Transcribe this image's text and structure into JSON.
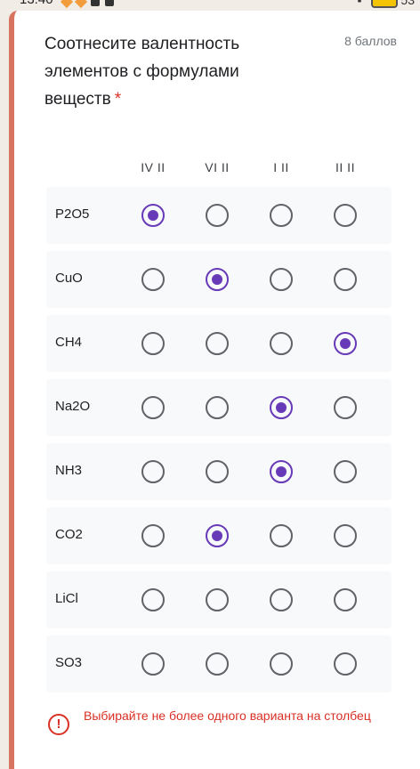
{
  "status_bar": {
    "time": "13:40",
    "battery": "53"
  },
  "question": {
    "title": "Соотнесите валентность элементов с формулами веществ",
    "required_mark": "*",
    "points": "8 баллов"
  },
  "columns": [
    "IV II",
    "VI II",
    "I II",
    "II II"
  ],
  "rows": [
    {
      "label": "P2O5",
      "selected": 0
    },
    {
      "label": "CuO",
      "selected": 1
    },
    {
      "label": "CH4",
      "selected": 3
    },
    {
      "label": "Na2O",
      "selected": 2
    },
    {
      "label": "NH3",
      "selected": 2
    },
    {
      "label": "CO2",
      "selected": 1
    },
    {
      "label": "LiCl",
      "selected": null
    },
    {
      "label": "SO3",
      "selected": null
    }
  ],
  "validation": {
    "message": "Выбирайте не более одного варианта на столбец",
    "icon": "error-icon"
  },
  "colors": {
    "accent": "#673ab7",
    "error": "#d93025",
    "card_border": "#d8735f"
  }
}
